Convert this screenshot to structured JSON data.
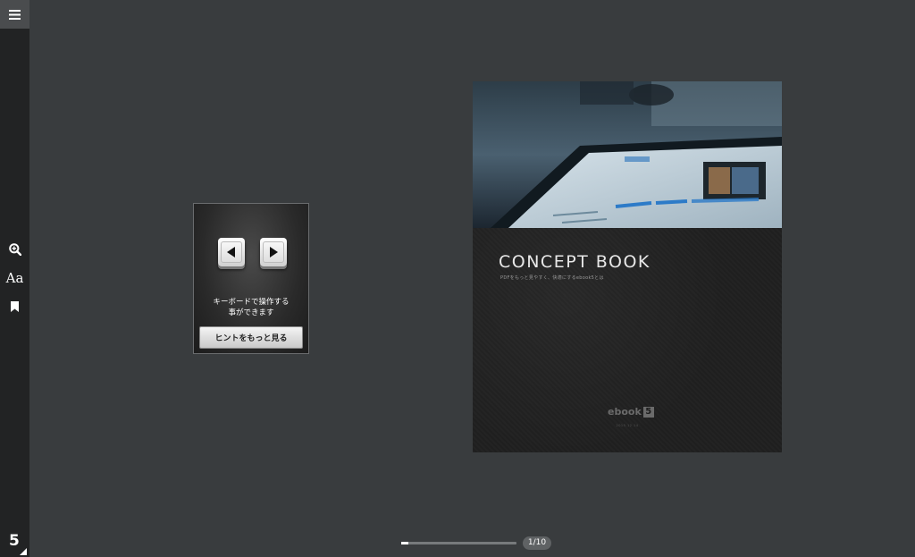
{
  "sidebar": {
    "menu_icon": "hamburger-menu-icon",
    "tools": [
      {
        "name": "zoom-in-icon"
      },
      {
        "name": "font-size-icon",
        "label": "Aa"
      },
      {
        "name": "bookmark-icon"
      }
    ],
    "brand_number": "5"
  },
  "hint_popup": {
    "line1": "キーボードで操作する",
    "line2": "事ができます",
    "button_label": "ヒントをもっと見る"
  },
  "book": {
    "title": "CONCEPT BOOK",
    "subtitle": "PDFをもっと見やすく、快適にするebook5とは",
    "logo_text": "ebook",
    "logo_number": "5",
    "tagline": "2015.12.14"
  },
  "progress": {
    "current_page": 1,
    "total_pages": 10,
    "counter_label": "1/10",
    "fraction": 0.06
  },
  "colors": {
    "background": "#393c3e",
    "sidebar": "#222324",
    "accent": "#ffffff"
  }
}
